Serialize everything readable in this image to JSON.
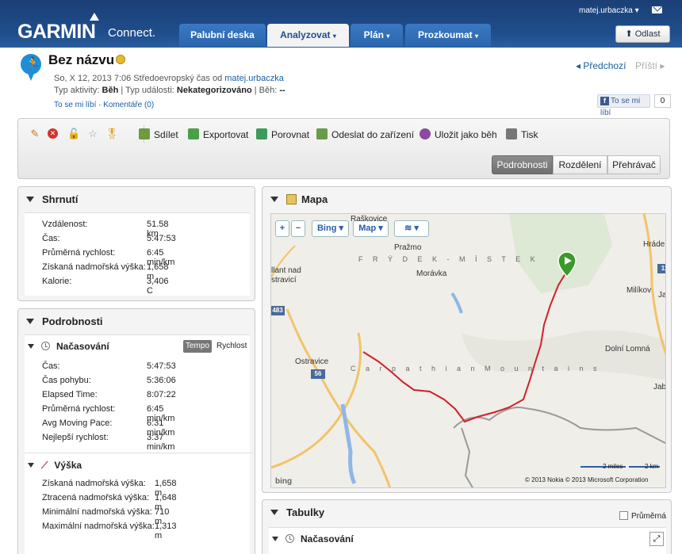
{
  "header": {
    "brand": "GARMIN",
    "brand_sub": "Connect.",
    "user": "matej.urbaczka",
    "nav": [
      "Palubní deska",
      "Analyzovat",
      "Plán",
      "Prozkoumat"
    ],
    "logout": "Odlast"
  },
  "activity": {
    "title": "Bez názvu",
    "meta_date": "So, X 12, 2013 7:06 Středoevropský čas od",
    "meta_user": "matej.urbaczka",
    "activity_type_label": "Typ aktivity:",
    "activity_type": "Běh",
    "event_type_label": "| Typ události:",
    "event_type": "Nekategorizováno",
    "course_label": "| Běh:",
    "course": "--",
    "like": "To se mi líbí",
    "comments": "Komentáře (0)",
    "prev": "Předchozí",
    "next": "Příští",
    "fb_label": "To se mi líbí",
    "fb_count": "0"
  },
  "toolbar": {
    "actions": [
      "Sdílet",
      "Exportovat",
      "Porovnat",
      "Odeslat do zařízení",
      "Uložit jako běh",
      "Tisk"
    ],
    "views": [
      "Podrobnosti",
      "Rozdělení",
      "Přehrávač"
    ]
  },
  "summary": {
    "title": "Shrnutí",
    "rows": [
      {
        "label": "Vzdálenost:",
        "value": "51.58 km"
      },
      {
        "label": "Čas:",
        "value": "5:47:53"
      },
      {
        "label": "Průměrná rychlost:",
        "value": "6:45 min/km"
      },
      {
        "label": "Získaná nadmořská výška:",
        "value": "1,658 m"
      },
      {
        "label": "Kalorie:",
        "value": "3,406 C"
      }
    ]
  },
  "details": {
    "title": "Podrobnosti",
    "timing_title": "Načasování",
    "toggle": [
      "Tempo",
      "Rychlost"
    ],
    "timing_rows": [
      {
        "label": "Čas:",
        "value": "5:47:53"
      },
      {
        "label": "Čas pohybu:",
        "value": "5:36:06"
      },
      {
        "label": "Elapsed Time:",
        "value": "8:07:22"
      },
      {
        "label": "Průměrná rychlost:",
        "value": "6:45 min/km"
      },
      {
        "label": "Avg Moving Pace:",
        "value": "6:31 min/km"
      },
      {
        "label": "Nejlepší rychlost:",
        "value": "3:37 min/km"
      }
    ],
    "elev_title": "Výška",
    "elev_rows": [
      {
        "label": "Získaná nadmořská výška:",
        "value": "1,658 m"
      },
      {
        "label": "Ztracená nadmořská výška:",
        "value": "1,648 m"
      },
      {
        "label": "Minimální nadmořská výška:",
        "value": "710 m"
      },
      {
        "label": "Maximální nadmořská výška:",
        "value": "1,313 m"
      }
    ]
  },
  "map": {
    "title": "Mapa",
    "controls": {
      "zoom_in": "+",
      "zoom_out": "−",
      "provider": "Bing",
      "type": "Map"
    },
    "labels": [
      "Raškovice",
      "Pražmo",
      "F R Ý D E K - M Í S T E K",
      "Morávka",
      "llant nad",
      "stravicí",
      "Ostravice",
      "C a r p a t h i a n   M o u n t a i n s",
      "Dolní Lomná",
      "Milíkov",
      "Hráde",
      "Jab",
      "Jabl"
    ],
    "roads": [
      "483",
      "56",
      "11"
    ],
    "scale_miles": "2 miles",
    "scale_km": "2 km",
    "bing": "bing",
    "copyright": "© 2013 Nokia   © 2013 Microsoft Corporation"
  },
  "tables": {
    "title": "Tabulky",
    "avg_label": "Průměrná",
    "sub_title": "Načasování"
  },
  "colors": {
    "accent": "#1f4e8c",
    "route": "#d0202a",
    "marker": "#3a9a2a"
  }
}
